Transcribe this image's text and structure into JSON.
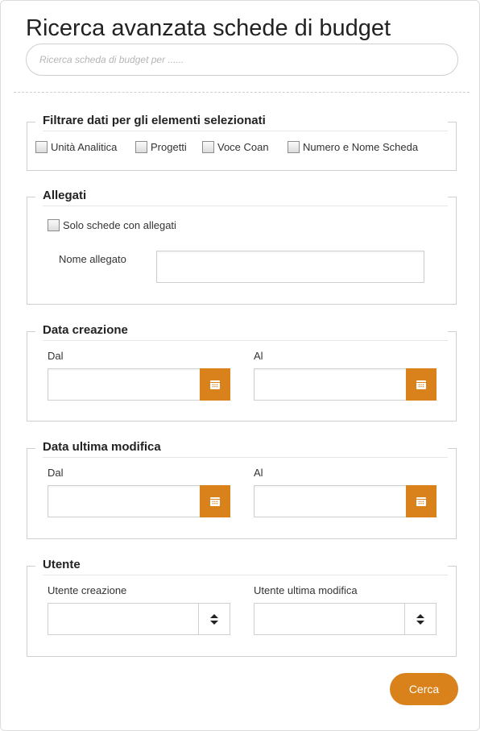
{
  "title": "Ricerca avanzata schede di budget",
  "search": {
    "placeholder": "Ricerca scheda di budget per ......"
  },
  "filters": {
    "legend": "Filtrare dati per gli elementi selezionati",
    "options": [
      {
        "label": "Unità Analitica",
        "checked": false
      },
      {
        "label": "Progetti",
        "checked": false
      },
      {
        "label": "Voce Coan",
        "checked": false
      },
      {
        "label": "Numero e Nome Scheda",
        "checked": false
      }
    ]
  },
  "attachments": {
    "legend": "Allegati",
    "only_with_attachments": {
      "label": "Solo schede con allegati",
      "checked": false
    },
    "attachment_name_label": "Nome allegato",
    "attachment_name_value": ""
  },
  "created": {
    "legend": "Data creazione",
    "from_label": "Dal",
    "to_label": "Al",
    "from_value": "",
    "to_value": ""
  },
  "modified": {
    "legend": "Data ultima modifica",
    "from_label": "Dal",
    "to_label": "Al",
    "from_value": "",
    "to_value": ""
  },
  "user": {
    "legend": "Utente",
    "created_by_label": "Utente creazione",
    "modified_by_label": "Utente ultima modifica",
    "created_by_value": "",
    "modified_by_value": ""
  },
  "actions": {
    "search_label": "Cerca"
  },
  "colors": {
    "accent": "#d9821b",
    "border": "#cfcfcf",
    "text": "#333333"
  },
  "icons": {
    "date_button": "calendar-icon",
    "select_button": "sort-arrows-icon"
  }
}
